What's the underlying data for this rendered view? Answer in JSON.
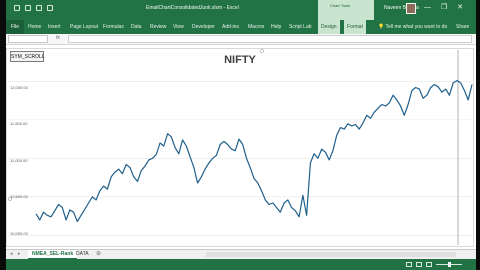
{
  "window": {
    "title": "EmailChartConsolidatedJunk.xlsm - Excel",
    "context_tab_group": "Chart Tools",
    "user_name": "Naveen Bhogra",
    "minimize": "—",
    "restore": "❐",
    "close": "✕"
  },
  "ribbon": {
    "tabs": [
      "File",
      "Home",
      "Insert",
      "Page Layout",
      "Formulas",
      "Data",
      "Review",
      "View",
      "Developer",
      "Add-ins",
      "Macros",
      "Help",
      "Script Lab",
      "Design",
      "Format"
    ],
    "tell_me": "Tell me what you want to do",
    "share": "Share"
  },
  "formula_bar": {
    "name_box": "",
    "fx_label": "fx",
    "value": ""
  },
  "chart": {
    "button_label": "SYM_SCROLL",
    "title": "NIFTY",
    "y_ticks": [
      "12,000.00",
      "11,500.00",
      "11,000.00",
      "10,500.00",
      "10,000.00"
    ]
  },
  "chart_data": {
    "type": "line",
    "title": "NIFTY",
    "xlabel": "",
    "ylabel": "",
    "ylim": [
      9900,
      12200
    ],
    "grid": true,
    "series": [
      {
        "color": "#1f5f8b",
        "values": [
          10280,
          10200,
          10300,
          10260,
          10240,
          10320,
          10400,
          10360,
          10200,
          10330,
          10300,
          10180,
          10260,
          10340,
          10420,
          10500,
          10460,
          10580,
          10640,
          10600,
          10760,
          10820,
          10860,
          10800,
          10920,
          10880,
          10760,
          10700,
          10840,
          10900,
          10980,
          11000,
          11050,
          11200,
          11160,
          11320,
          11280,
          11140,
          11060,
          11240,
          11160,
          11020,
          10880,
          10680,
          10760,
          10860,
          10940,
          11000,
          11040,
          11180,
          11220,
          11180,
          11120,
          11100,
          11250,
          11180,
          11000,
          10880,
          10740,
          10680,
          10580,
          10460,
          10400,
          10420,
          10360,
          10300,
          10420,
          10460,
          10360,
          10320,
          10240,
          10520,
          10260,
          10940,
          11060,
          11000,
          11120,
          11080,
          10980,
          11100,
          11300,
          11400,
          11380,
          11450,
          11420,
          11440,
          11380,
          11460,
          11560,
          11520,
          11600,
          11650,
          11700,
          11680,
          11720,
          11820,
          11760,
          11680,
          11560,
          11700,
          11880,
          11920,
          11900,
          11780,
          11820,
          11920,
          11960,
          11930,
          11860,
          11900,
          11820,
          11980,
          12010,
          11980,
          11880,
          11760,
          11960
        ]
      }
    ]
  },
  "sheet_tabs": {
    "nav": "◂ ▸",
    "tabs": [
      "NMEA_SEL-Rank",
      "DATA"
    ],
    "add": "⊕"
  },
  "status": {
    "ready": ""
  }
}
